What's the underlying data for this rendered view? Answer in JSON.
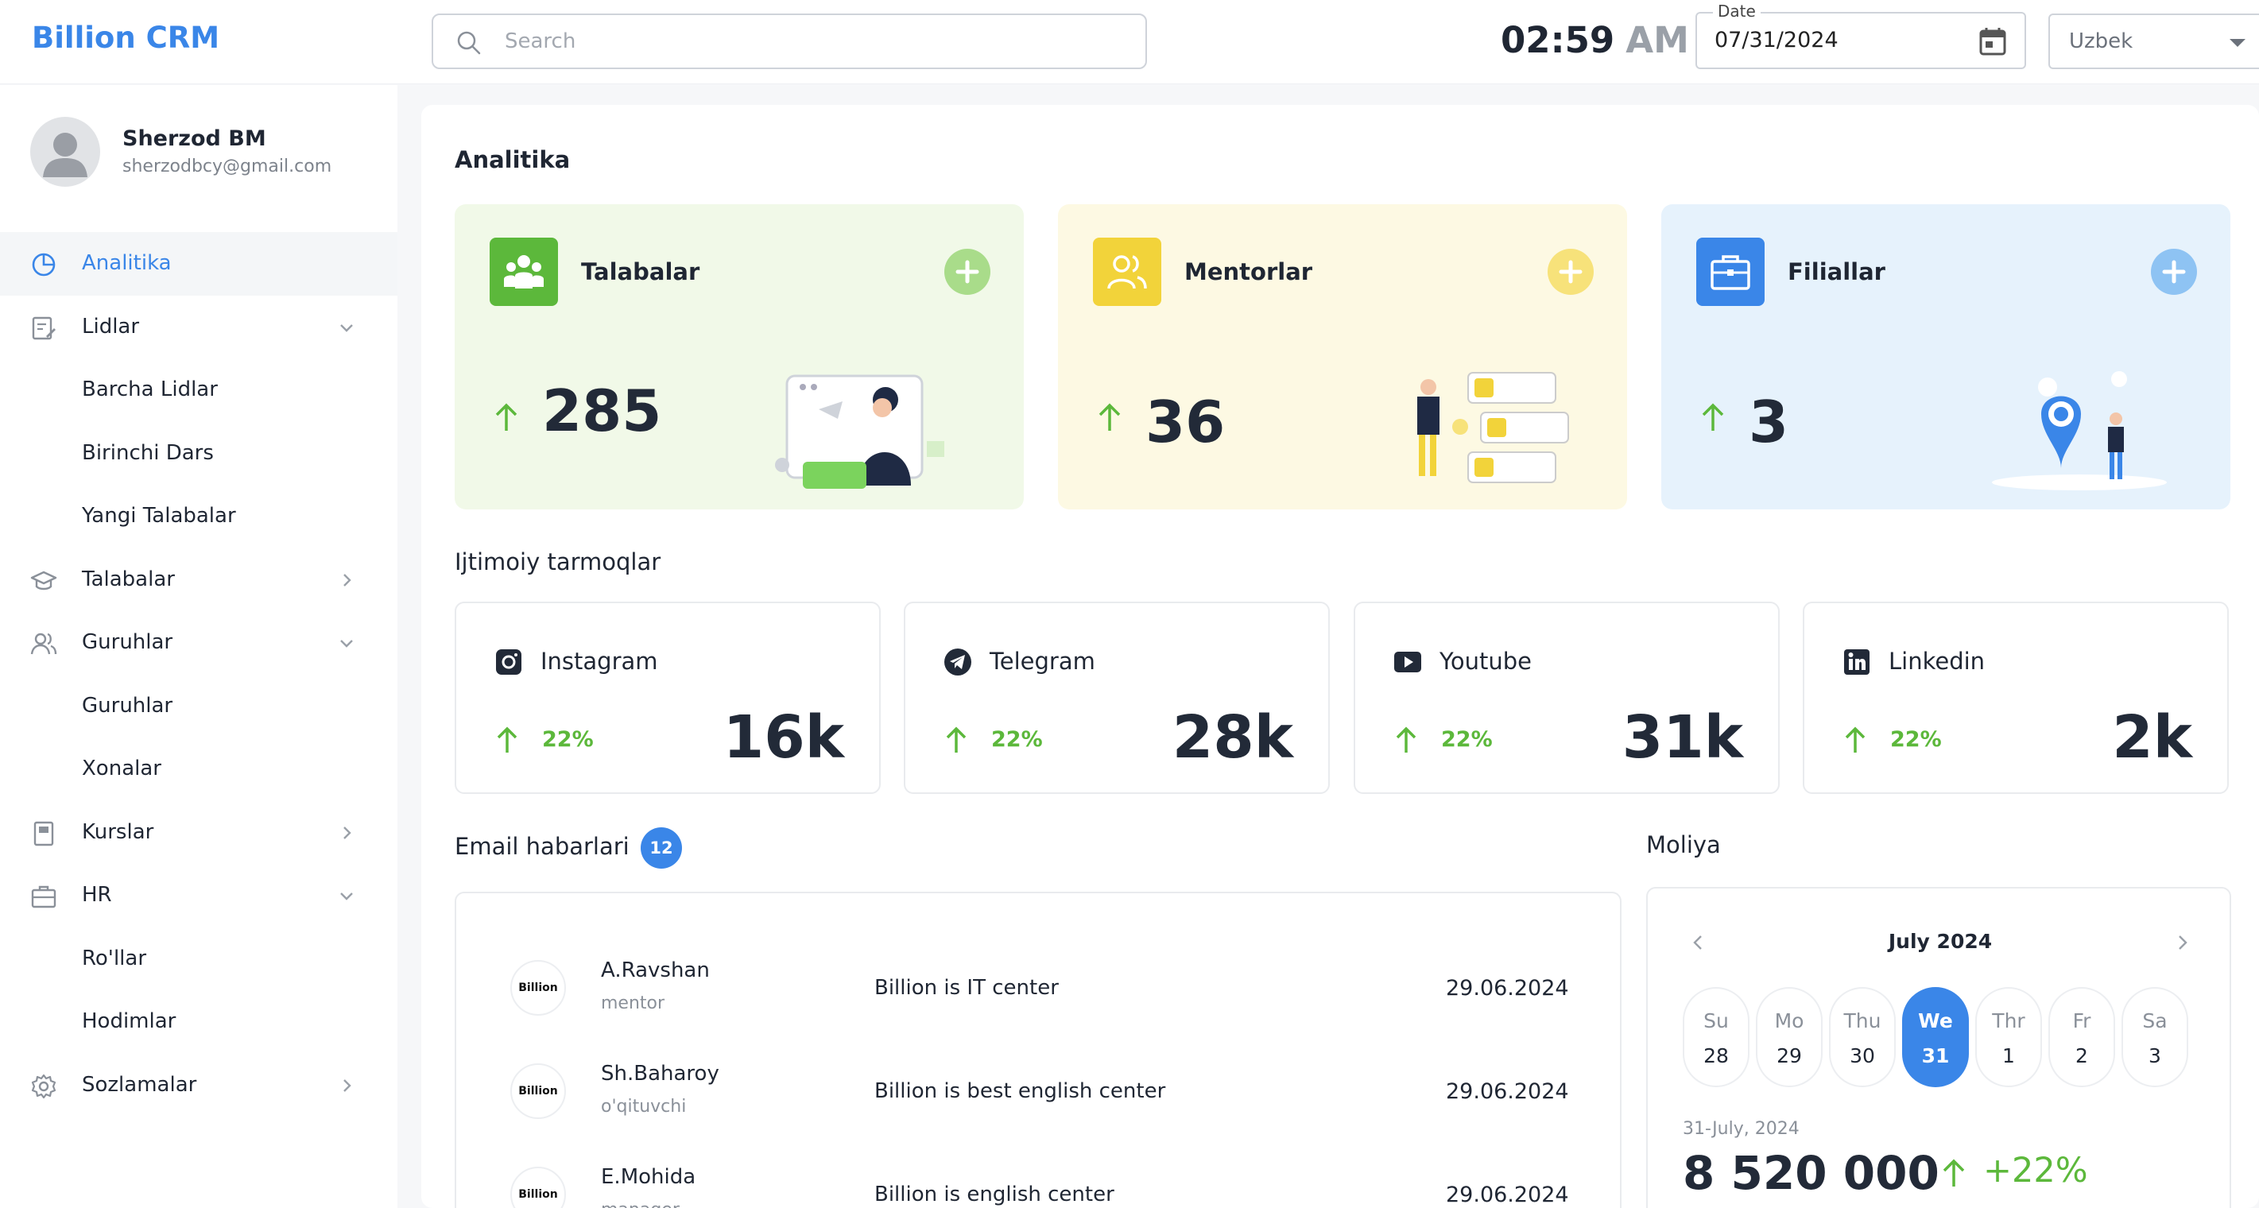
{
  "app": {
    "brand": "Billion CRM"
  },
  "header": {
    "search_placeholder": "Search",
    "time": "02:59",
    "ampm": "AM",
    "date_label": "Date",
    "date_value": "07/31/2024",
    "language": "Uzbek"
  },
  "profile": {
    "name": "Sherzod BM",
    "email": "sherzodbcy@gmail.com"
  },
  "sidebar": {
    "items": [
      {
        "label": "Analitika",
        "icon": "pie-chart-icon",
        "active": true
      },
      {
        "label": "Lidlar",
        "icon": "clipboard-edit-icon",
        "expanded": true
      },
      {
        "label": "Barcha Lidlar",
        "sub": true
      },
      {
        "label": "Birinchi Dars",
        "sub": true
      },
      {
        "label": "Yangi Talabalar",
        "sub": true
      },
      {
        "label": "Talabalar",
        "icon": "graduation-cap-icon"
      },
      {
        "label": "Guruhlar",
        "icon": "users-icon",
        "expanded": true
      },
      {
        "label": "Guruhlar",
        "sub": true
      },
      {
        "label": "Xonalar",
        "sub": true
      },
      {
        "label": "Kurslar",
        "icon": "book-icon"
      },
      {
        "label": "HR",
        "icon": "briefcase-icon",
        "expanded": true
      },
      {
        "label": "Ro'llar",
        "sub": true
      },
      {
        "label": "Hodimlar",
        "sub": true
      },
      {
        "label": "Sozlamalar",
        "icon": "gear-icon"
      }
    ]
  },
  "main": {
    "analytics_title": "Analitika",
    "stats": [
      {
        "title": "Talabalar",
        "value": "285",
        "bg": "#f1f9e8",
        "accent": "#5cb83b",
        "plus": "#a9dc8a"
      },
      {
        "title": "Mentorlar",
        "value": "36",
        "bg": "#fdf9e3",
        "accent": "#f2d33a",
        "plus": "#f7e27a"
      },
      {
        "title": "Filiallar",
        "value": "3",
        "bg": "#e6f2fc",
        "accent": "#3a86e8",
        "plus": "#8ec3f3"
      }
    ],
    "social_title": "Ijtimoiy tarmoqlar",
    "social": [
      {
        "name": "Instagram",
        "pct": "22%",
        "value": "16k",
        "icon": "instagram-icon"
      },
      {
        "name": "Telegram",
        "pct": "22%",
        "value": "28k",
        "icon": "telegram-icon"
      },
      {
        "name": "Youtube",
        "pct": "22%",
        "value": "31k",
        "icon": "youtube-icon"
      },
      {
        "name": "Linkedin",
        "pct": "22%",
        "value": "2k",
        "icon": "linkedin-icon"
      }
    ],
    "email_title": "Email habarlari",
    "email_count": "12",
    "emails": [
      {
        "logo": "Billion",
        "name": "A.Ravshan",
        "role": "mentor",
        "subject": "Billion is IT center",
        "date": "29.06.2024"
      },
      {
        "logo": "Billion",
        "name": "Sh.Baharoy",
        "role": "o'qituvchi",
        "subject": "Billion is best english center",
        "date": "29.06.2024"
      },
      {
        "logo": "Billion",
        "name": "E.Mohida",
        "role": "manager",
        "subject": "Billion is english center",
        "date": "29.06.2024"
      }
    ],
    "finance": {
      "title": "Moliya",
      "month": "July 2024",
      "days": [
        {
          "name": "Su",
          "num": "28"
        },
        {
          "name": "Mo",
          "num": "29"
        },
        {
          "name": "Thu",
          "num": "30"
        },
        {
          "name": "We",
          "num": "31",
          "selected": true
        },
        {
          "name": "Thr",
          "num": "1"
        },
        {
          "name": "Fr",
          "num": "2"
        },
        {
          "name": "Sa",
          "num": "3"
        }
      ],
      "date": "31-July, 2024",
      "amount": "8 520 000",
      "change": "+22%"
    }
  }
}
